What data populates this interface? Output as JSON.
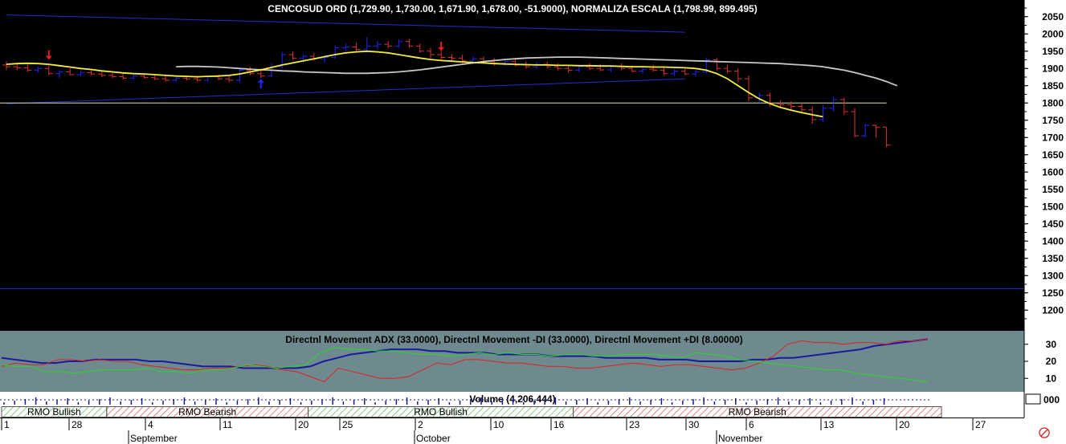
{
  "colors": {
    "up": "#2222ff",
    "down": "#e03030",
    "ma_yellow": "#f5ee3a",
    "ma_grey": "#c8c8c8",
    "band_blue": "#2030c8",
    "adx": "#1a1aa0",
    "minus_di": "#e02020",
    "plus_di": "#22dd22",
    "rmo_bull": "#33aa33",
    "rmo_bear": "#cc3333"
  },
  "chart_data": [
    {
      "type": "ohlc",
      "title": "CENCOSUD ORD (1,729.90, 1,730.00, 1,671.90, 1,678.00, -51.9000), NORMALIZA ESCALA (1,798.99, 899.495)",
      "ylim": [
        1175,
        2075
      ],
      "yticks": [
        1200,
        1250,
        1300,
        1350,
        1400,
        1450,
        1500,
        1550,
        1600,
        1650,
        1700,
        1750,
        1800,
        1850,
        1900,
        1950,
        2000,
        2050
      ],
      "x_start": "Aug 21",
      "x_end": "Dec 1",
      "bars": [
        {
          "x": 0,
          "o": 1910,
          "h": 1920,
          "l": 1895,
          "c": 1905
        },
        {
          "x": 1,
          "o": 1905,
          "h": 1912,
          "l": 1895,
          "c": 1902
        },
        {
          "x": 2,
          "o": 1902,
          "h": 1910,
          "l": 1890,
          "c": 1895
        },
        {
          "x": 3,
          "o": 1895,
          "h": 1905,
          "l": 1888,
          "c": 1900
        },
        {
          "x": 4,
          "o": 1900,
          "h": 1908,
          "l": 1880,
          "c": 1885
        },
        {
          "x": 5,
          "o": 1885,
          "h": 1895,
          "l": 1872,
          "c": 1890
        },
        {
          "x": 6,
          "o": 1890,
          "h": 1900,
          "l": 1880,
          "c": 1882
        },
        {
          "x": 7,
          "o": 1882,
          "h": 1895,
          "l": 1878,
          "c": 1888
        },
        {
          "x": 8,
          "o": 1888,
          "h": 1896,
          "l": 1880,
          "c": 1884
        },
        {
          "x": 9,
          "o": 1884,
          "h": 1890,
          "l": 1875,
          "c": 1880
        },
        {
          "x": 10,
          "o": 1880,
          "h": 1888,
          "l": 1872,
          "c": 1876
        },
        {
          "x": 11,
          "o": 1876,
          "h": 1885,
          "l": 1868,
          "c": 1872
        },
        {
          "x": 12,
          "o": 1872,
          "h": 1882,
          "l": 1868,
          "c": 1878
        },
        {
          "x": 13,
          "o": 1878,
          "h": 1885,
          "l": 1870,
          "c": 1874
        },
        {
          "x": 14,
          "o": 1874,
          "h": 1880,
          "l": 1866,
          "c": 1870
        },
        {
          "x": 15,
          "o": 1870,
          "h": 1878,
          "l": 1862,
          "c": 1866
        },
        {
          "x": 16,
          "o": 1866,
          "h": 1875,
          "l": 1860,
          "c": 1872
        },
        {
          "x": 17,
          "o": 1872,
          "h": 1880,
          "l": 1865,
          "c": 1870
        },
        {
          "x": 18,
          "o": 1870,
          "h": 1878,
          "l": 1862,
          "c": 1866
        },
        {
          "x": 19,
          "o": 1866,
          "h": 1880,
          "l": 1862,
          "c": 1876
        },
        {
          "x": 20,
          "o": 1876,
          "h": 1882,
          "l": 1866,
          "c": 1870
        },
        {
          "x": 21,
          "o": 1870,
          "h": 1878,
          "l": 1860,
          "c": 1866
        },
        {
          "x": 22,
          "o": 1866,
          "h": 1898,
          "l": 1860,
          "c": 1895
        },
        {
          "x": 23,
          "o": 1895,
          "h": 1905,
          "l": 1880,
          "c": 1885
        },
        {
          "x": 24,
          "o": 1885,
          "h": 1900,
          "l": 1872,
          "c": 1878
        },
        {
          "x": 25,
          "o": 1878,
          "h": 1915,
          "l": 1875,
          "c": 1905
        },
        {
          "x": 26,
          "o": 1905,
          "h": 1948,
          "l": 1900,
          "c": 1940
        },
        {
          "x": 27,
          "o": 1940,
          "h": 1950,
          "l": 1925,
          "c": 1930
        },
        {
          "x": 28,
          "o": 1930,
          "h": 1940,
          "l": 1918,
          "c": 1935
        },
        {
          "x": 29,
          "o": 1935,
          "h": 1945,
          "l": 1922,
          "c": 1928
        },
        {
          "x": 30,
          "o": 1928,
          "h": 1938,
          "l": 1915,
          "c": 1932
        },
        {
          "x": 31,
          "o": 1932,
          "h": 1965,
          "l": 1928,
          "c": 1960
        },
        {
          "x": 32,
          "o": 1960,
          "h": 1972,
          "l": 1950,
          "c": 1962
        },
        {
          "x": 33,
          "o": 1962,
          "h": 1975,
          "l": 1950,
          "c": 1955
        },
        {
          "x": 34,
          "o": 1955,
          "h": 1990,
          "l": 1948,
          "c": 1965
        },
        {
          "x": 35,
          "o": 1965,
          "h": 1980,
          "l": 1955,
          "c": 1970
        },
        {
          "x": 36,
          "o": 1970,
          "h": 1980,
          "l": 1958,
          "c": 1965
        },
        {
          "x": 37,
          "o": 1965,
          "h": 1985,
          "l": 1960,
          "c": 1978
        },
        {
          "x": 38,
          "o": 1978,
          "h": 1985,
          "l": 1960,
          "c": 1965
        },
        {
          "x": 39,
          "o": 1965,
          "h": 1972,
          "l": 1945,
          "c": 1950
        },
        {
          "x": 40,
          "o": 1950,
          "h": 1960,
          "l": 1930,
          "c": 1940
        },
        {
          "x": 41,
          "o": 1940,
          "h": 1950,
          "l": 1925,
          "c": 1932
        },
        {
          "x": 42,
          "o": 1932,
          "h": 1942,
          "l": 1920,
          "c": 1930
        },
        {
          "x": 43,
          "o": 1930,
          "h": 1940,
          "l": 1915,
          "c": 1922
        },
        {
          "x": 44,
          "o": 1922,
          "h": 1935,
          "l": 1912,
          "c": 1928
        },
        {
          "x": 45,
          "o": 1928,
          "h": 1935,
          "l": 1915,
          "c": 1920
        },
        {
          "x": 46,
          "o": 1920,
          "h": 1930,
          "l": 1908,
          "c": 1915
        },
        {
          "x": 47,
          "o": 1915,
          "h": 1925,
          "l": 1908,
          "c": 1920
        },
        {
          "x": 48,
          "o": 1920,
          "h": 1928,
          "l": 1905,
          "c": 1910
        },
        {
          "x": 49,
          "o": 1910,
          "h": 1920,
          "l": 1900,
          "c": 1905
        },
        {
          "x": 50,
          "o": 1905,
          "h": 1918,
          "l": 1898,
          "c": 1912
        },
        {
          "x": 51,
          "o": 1912,
          "h": 1920,
          "l": 1900,
          "c": 1905
        },
        {
          "x": 52,
          "o": 1905,
          "h": 1915,
          "l": 1895,
          "c": 1900
        },
        {
          "x": 53,
          "o": 1900,
          "h": 1910,
          "l": 1888,
          "c": 1895
        },
        {
          "x": 54,
          "o": 1895,
          "h": 1910,
          "l": 1890,
          "c": 1905
        },
        {
          "x": 55,
          "o": 1905,
          "h": 1915,
          "l": 1895,
          "c": 1900
        },
        {
          "x": 56,
          "o": 1900,
          "h": 1912,
          "l": 1892,
          "c": 1896
        },
        {
          "x": 57,
          "o": 1896,
          "h": 1910,
          "l": 1890,
          "c": 1905
        },
        {
          "x": 58,
          "o": 1905,
          "h": 1915,
          "l": 1895,
          "c": 1900
        },
        {
          "x": 59,
          "o": 1900,
          "h": 1908,
          "l": 1888,
          "c": 1892
        },
        {
          "x": 60,
          "o": 1892,
          "h": 1905,
          "l": 1885,
          "c": 1898
        },
        {
          "x": 61,
          "o": 1898,
          "h": 1910,
          "l": 1890,
          "c": 1895
        },
        {
          "x": 62,
          "o": 1895,
          "h": 1902,
          "l": 1880,
          "c": 1885
        },
        {
          "x": 63,
          "o": 1885,
          "h": 1898,
          "l": 1878,
          "c": 1892
        },
        {
          "x": 64,
          "o": 1892,
          "h": 1900,
          "l": 1880,
          "c": 1884
        },
        {
          "x": 65,
          "o": 1884,
          "h": 1896,
          "l": 1876,
          "c": 1890
        },
        {
          "x": 66,
          "o": 1890,
          "h": 1932,
          "l": 1885,
          "c": 1925
        },
        {
          "x": 67,
          "o": 1925,
          "h": 1930,
          "l": 1895,
          "c": 1900
        },
        {
          "x": 68,
          "o": 1900,
          "h": 1910,
          "l": 1885,
          "c": 1892
        },
        {
          "x": 69,
          "o": 1892,
          "h": 1900,
          "l": 1860,
          "c": 1870
        },
        {
          "x": 70,
          "o": 1870,
          "h": 1880,
          "l": 1805,
          "c": 1815
        },
        {
          "x": 71,
          "o": 1815,
          "h": 1830,
          "l": 1800,
          "c": 1822
        },
        {
          "x": 72,
          "o": 1822,
          "h": 1830,
          "l": 1790,
          "c": 1798
        },
        {
          "x": 73,
          "o": 1798,
          "h": 1808,
          "l": 1785,
          "c": 1795
        },
        {
          "x": 74,
          "o": 1795,
          "h": 1805,
          "l": 1780,
          "c": 1790
        },
        {
          "x": 75,
          "o": 1790,
          "h": 1800,
          "l": 1770,
          "c": 1780
        },
        {
          "x": 76,
          "o": 1780,
          "h": 1790,
          "l": 1740,
          "c": 1752
        },
        {
          "x": 77,
          "o": 1752,
          "h": 1795,
          "l": 1745,
          "c": 1785
        },
        {
          "x": 78,
          "o": 1785,
          "h": 1818,
          "l": 1775,
          "c": 1810
        },
        {
          "x": 79,
          "o": 1810,
          "h": 1815,
          "l": 1765,
          "c": 1775
        },
        {
          "x": 80,
          "o": 1775,
          "h": 1785,
          "l": 1700,
          "c": 1705
        },
        {
          "x": 81,
          "o": 1705,
          "h": 1740,
          "l": 1700,
          "c": 1735
        },
        {
          "x": 82,
          "o": 1735,
          "h": 1738,
          "l": 1700,
          "c": 1730
        },
        {
          "x": 83,
          "o": 1730,
          "h": 1730,
          "l": 1672,
          "c": 1678
        }
      ],
      "ma_fast": [
        1912,
        1914,
        1915,
        1914,
        1912,
        1908,
        1904,
        1900,
        1897,
        1893,
        1890,
        1887,
        1885,
        1884,
        1882,
        1880,
        1878,
        1877,
        1876,
        1877,
        1878,
        1880,
        1884,
        1890,
        1896,
        1903,
        1910,
        1916,
        1922,
        1928,
        1934,
        1940,
        1945,
        1948,
        1950,
        1948,
        1945,
        1940,
        1935,
        1930,
        1926,
        1923,
        1921,
        1919,
        1917,
        1916,
        1914,
        1913,
        1912,
        1911,
        1910,
        1910,
        1909,
        1909,
        1908,
        1908,
        1907,
        1907,
        1906,
        1905,
        1905,
        1904,
        1904,
        1903,
        1902,
        1900,
        1895,
        1885,
        1870,
        1850,
        1830,
        1812,
        1798,
        1787,
        1779,
        1772,
        1766,
        1760
      ],
      "ma_fast_start": 0,
      "ma_slow": [
        1905,
        1906,
        1906,
        1905,
        1904,
        1902,
        1900,
        1898,
        1896,
        1895,
        1893,
        1892,
        1890,
        1889,
        1888,
        1887,
        1886,
        1886,
        1886,
        1887,
        1888,
        1890,
        1893,
        1896,
        1900,
        1904,
        1908,
        1912,
        1916,
        1920,
        1923,
        1926,
        1928,
        1930,
        1931,
        1932,
        1933,
        1933,
        1933,
        1932,
        1931,
        1930,
        1929,
        1928,
        1927,
        1926,
        1925,
        1924,
        1923,
        1922,
        1921,
        1920,
        1919,
        1918,
        1917,
        1916,
        1915,
        1914,
        1912,
        1910,
        1908,
        1905,
        1900,
        1895,
        1888,
        1880,
        1872,
        1862,
        1850
      ],
      "ma_slow_start": 16,
      "band_upper": [
        [
          0,
          2055
        ],
        [
          64,
          2005
        ]
      ],
      "band_lower": [
        [
          0,
          1798
        ],
        [
          64,
          1870
        ]
      ],
      "band_h1": 1262,
      "band_h2": 1800,
      "band_h2_end": 83,
      "arrows": [
        {
          "x": 4,
          "price": 1925,
          "dir": "down",
          "color": "#e02020"
        },
        {
          "x": 24,
          "price": 1870,
          "dir": "up",
          "color": "#2222ff"
        },
        {
          "x": 41,
          "price": 1950,
          "dir": "down",
          "color": "#e02020"
        }
      ]
    },
    {
      "type": "line",
      "title": "Directnl Movement ADX (33.0000), Directnl Movement -DI (33.0000), Directnl Movement +DI (8.00000)",
      "ylim": [
        4,
        36
      ],
      "yticks": [
        10,
        20,
        30
      ],
      "series": [
        {
          "name": "Directnl Movement ADX",
          "values": [
            22,
            21,
            20,
            19,
            19,
            20,
            20,
            21,
            21,
            21,
            21,
            20,
            20,
            19,
            18,
            17,
            17,
            17,
            16,
            16,
            16,
            16,
            16,
            17,
            20,
            22,
            24,
            25,
            26,
            27,
            27,
            27,
            26,
            26,
            25,
            25,
            25,
            24,
            24,
            24,
            24,
            23,
            23,
            23,
            23,
            22,
            22,
            22,
            22,
            21,
            21,
            21,
            20,
            20,
            20,
            20,
            21,
            21,
            22,
            22,
            23,
            24,
            25,
            26,
            27,
            29,
            30,
            31,
            32,
            33
          ]
        },
        {
          "name": "Directnl Movement -DI",
          "values": [
            17,
            19,
            18,
            18,
            21,
            21,
            20,
            21,
            20,
            20,
            18,
            17,
            16,
            15,
            15,
            16,
            16,
            17,
            18,
            17,
            15,
            14,
            11,
            8,
            16,
            14,
            12,
            10,
            10,
            11,
            15,
            19,
            18,
            21,
            21,
            20,
            19,
            19,
            18,
            17,
            17,
            16,
            16,
            17,
            18,
            19,
            18,
            17,
            18,
            18,
            17,
            16,
            15,
            16,
            19,
            23,
            30,
            32,
            31,
            31,
            30,
            31,
            31,
            30,
            32,
            32,
            33
          ]
        },
        {
          "name": "Directnl Movement +DI",
          "values": [
            18,
            17,
            17,
            14,
            14,
            13,
            14,
            15,
            15,
            15,
            16,
            14,
            14,
            13,
            15,
            15,
            16,
            18,
            17,
            16,
            17,
            18,
            25,
            28,
            27,
            27,
            26,
            26,
            25,
            24,
            24,
            23,
            24,
            25,
            24,
            25,
            24,
            24,
            23,
            24,
            24,
            23,
            23,
            24,
            24,
            24,
            23,
            22,
            25,
            24,
            23,
            21,
            20,
            19,
            18,
            17,
            16,
            15,
            15,
            13,
            12,
            11,
            10,
            9,
            8
          ]
        }
      ]
    },
    {
      "type": "bar",
      "title": "Volume (4,206,444)",
      "yticks_label": "000"
    }
  ],
  "rmo": [
    {
      "label": "RMO Bullish",
      "kind": "bull",
      "x0": 0,
      "x1": 9
    },
    {
      "label": "RMO Bearish",
      "kind": "bear",
      "x0": 9,
      "x1": 28
    },
    {
      "label": "RMO Bullish",
      "kind": "bull",
      "x0": 28,
      "x1": 53
    },
    {
      "label": "RMO Bearish",
      "kind": "bear",
      "x0": 53,
      "x1": 83
    }
  ],
  "date_ticks": [
    "1",
    "28",
    "4",
    "11",
    "20",
    "25",
    "2",
    "10",
    "16",
    "23",
    "30",
    "6",
    "13",
    "20",
    "27"
  ],
  "month_labels": [
    "September",
    "October",
    "November"
  ]
}
